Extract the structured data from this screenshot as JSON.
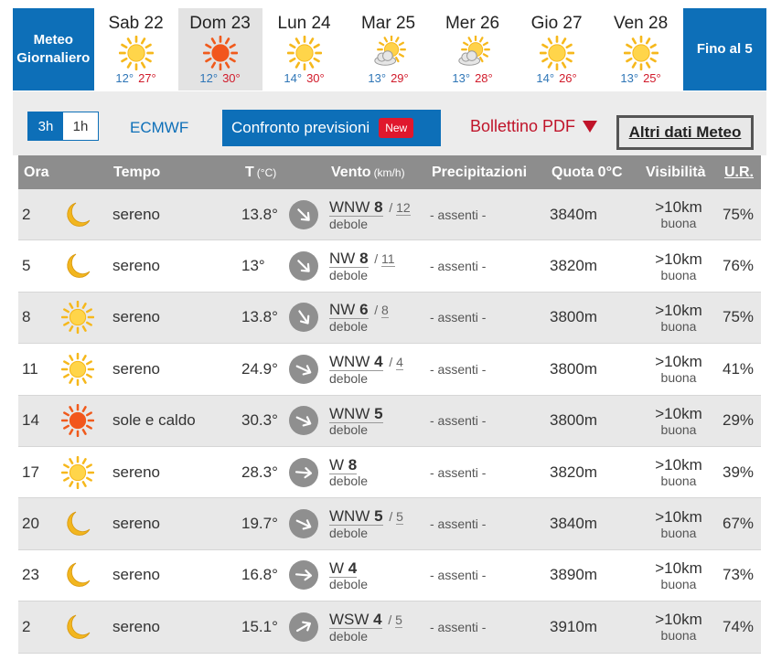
{
  "days": {
    "daily_label": "Meteo Giornaliero",
    "items": [
      {
        "name": "Sab 22",
        "icon": "sun-icon",
        "tmin": "12°",
        "tmax": "27°",
        "selected": false
      },
      {
        "name": "Dom 23",
        "icon": "hot-sun-icon",
        "tmin": "12°",
        "tmax": "30°",
        "selected": true
      },
      {
        "name": "Lun 24",
        "icon": "sun-icon",
        "tmin": "14°",
        "tmax": "30°",
        "selected": false
      },
      {
        "name": "Mar 25",
        "icon": "sun-cloud-icon",
        "tmin": "13°",
        "tmax": "29°",
        "selected": false
      },
      {
        "name": "Mer 26",
        "icon": "sun-cloud-icon",
        "tmin": "13°",
        "tmax": "28°",
        "selected": false
      },
      {
        "name": "Gio 27",
        "icon": "sun-icon",
        "tmin": "14°",
        "tmax": "26°",
        "selected": false
      },
      {
        "name": "Ven 28",
        "icon": "sun-icon",
        "tmin": "13°",
        "tmax": "25°",
        "selected": false
      }
    ],
    "fino_label": "Fino al 5"
  },
  "toolbar": {
    "seg_3h": "3h",
    "seg_1h": "1h",
    "model": "ECMWF",
    "compare_label": "Confronto previsioni",
    "new_badge": "New",
    "pdf_label": "Bollettino PDF",
    "altri_label": "Altri dati Meteo"
  },
  "table": {
    "headers": {
      "ora": "Ora",
      "tempo": "Tempo",
      "temp": "T",
      "temp_unit": "(°C)",
      "vento": "Vento",
      "vento_unit": "(km/h)",
      "prec": "Precipitazioni",
      "quota": "Quota 0°C",
      "vis": "Visibilità",
      "ur": "U.R."
    },
    "rows": [
      {
        "ora": "2",
        "icon": "moon-icon",
        "tempo": "sereno",
        "temp": "13.8°",
        "wind_angle": 45,
        "wind_dir": "WNW",
        "wind_speed": "8",
        "wind_gust": "12",
        "wind_desc": "debole",
        "prec": "- assenti -",
        "quota": "3840m",
        "vis": ">10km",
        "vis_desc": "buona",
        "ur": "75%"
      },
      {
        "ora": "5",
        "icon": "moon-icon",
        "tempo": "sereno",
        "temp": "13°",
        "wind_angle": 45,
        "wind_dir": "NW",
        "wind_speed": "8",
        "wind_gust": "11",
        "wind_desc": "debole",
        "prec": "- assenti -",
        "quota": "3820m",
        "vis": ">10km",
        "vis_desc": "buona",
        "ur": "76%"
      },
      {
        "ora": "8",
        "icon": "sun-icon",
        "tempo": "sereno",
        "temp": "13.8°",
        "wind_angle": 55,
        "wind_dir": "NW",
        "wind_speed": "6",
        "wind_gust": "8",
        "wind_desc": "debole",
        "prec": "- assenti -",
        "quota": "3800m",
        "vis": ">10km",
        "vis_desc": "buona",
        "ur": "75%"
      },
      {
        "ora": "11",
        "icon": "sun-icon",
        "tempo": "sereno",
        "temp": "24.9°",
        "wind_angle": 25,
        "wind_dir": "WNW",
        "wind_speed": "4",
        "wind_gust": "4",
        "wind_desc": "debole",
        "prec": "- assenti -",
        "quota": "3800m",
        "vis": ">10km",
        "vis_desc": "buona",
        "ur": "41%"
      },
      {
        "ora": "14",
        "icon": "hot-sun-icon",
        "tempo": "sole e caldo",
        "temp": "30.3°",
        "wind_angle": 25,
        "wind_dir": "WNW",
        "wind_speed": "5",
        "wind_gust": "",
        "wind_desc": "debole",
        "prec": "- assenti -",
        "quota": "3800m",
        "vis": ">10km",
        "vis_desc": "buona",
        "ur": "29%"
      },
      {
        "ora": "17",
        "icon": "sun-icon",
        "tempo": "sereno",
        "temp": "28.3°",
        "wind_angle": 5,
        "wind_dir": "W",
        "wind_speed": "8",
        "wind_gust": "",
        "wind_desc": "debole",
        "prec": "- assenti -",
        "quota": "3820m",
        "vis": ">10km",
        "vis_desc": "buona",
        "ur": "39%"
      },
      {
        "ora": "20",
        "icon": "moon-icon",
        "tempo": "sereno",
        "temp": "19.7°",
        "wind_angle": 25,
        "wind_dir": "WNW",
        "wind_speed": "5",
        "wind_gust": "5",
        "wind_desc": "debole",
        "prec": "- assenti -",
        "quota": "3840m",
        "vis": ">10km",
        "vis_desc": "buona",
        "ur": "67%"
      },
      {
        "ora": "23",
        "icon": "moon-icon",
        "tempo": "sereno",
        "temp": "16.8°",
        "wind_angle": 5,
        "wind_dir": "W",
        "wind_speed": "4",
        "wind_gust": "",
        "wind_desc": "debole",
        "prec": "- assenti -",
        "quota": "3890m",
        "vis": ">10km",
        "vis_desc": "buona",
        "ur": "73%"
      },
      {
        "ora": "2",
        "icon": "moon-icon",
        "tempo": "sereno",
        "temp": "15.1°",
        "wind_angle": -30,
        "wind_dir": "WSW",
        "wind_speed": "4",
        "wind_gust": "5",
        "wind_desc": "debole",
        "prec": "- assenti -",
        "quota": "3910m",
        "vis": ">10km",
        "vis_desc": "buona",
        "ur": "74%"
      }
    ]
  },
  "colors": {
    "accent": "#0d6fb8",
    "min_temp": "#2f76b7",
    "max_temp": "#d11a2a",
    "sun": "#f6b81c",
    "hot_sun": "#f05a1c",
    "moon": "#f2b61f"
  }
}
